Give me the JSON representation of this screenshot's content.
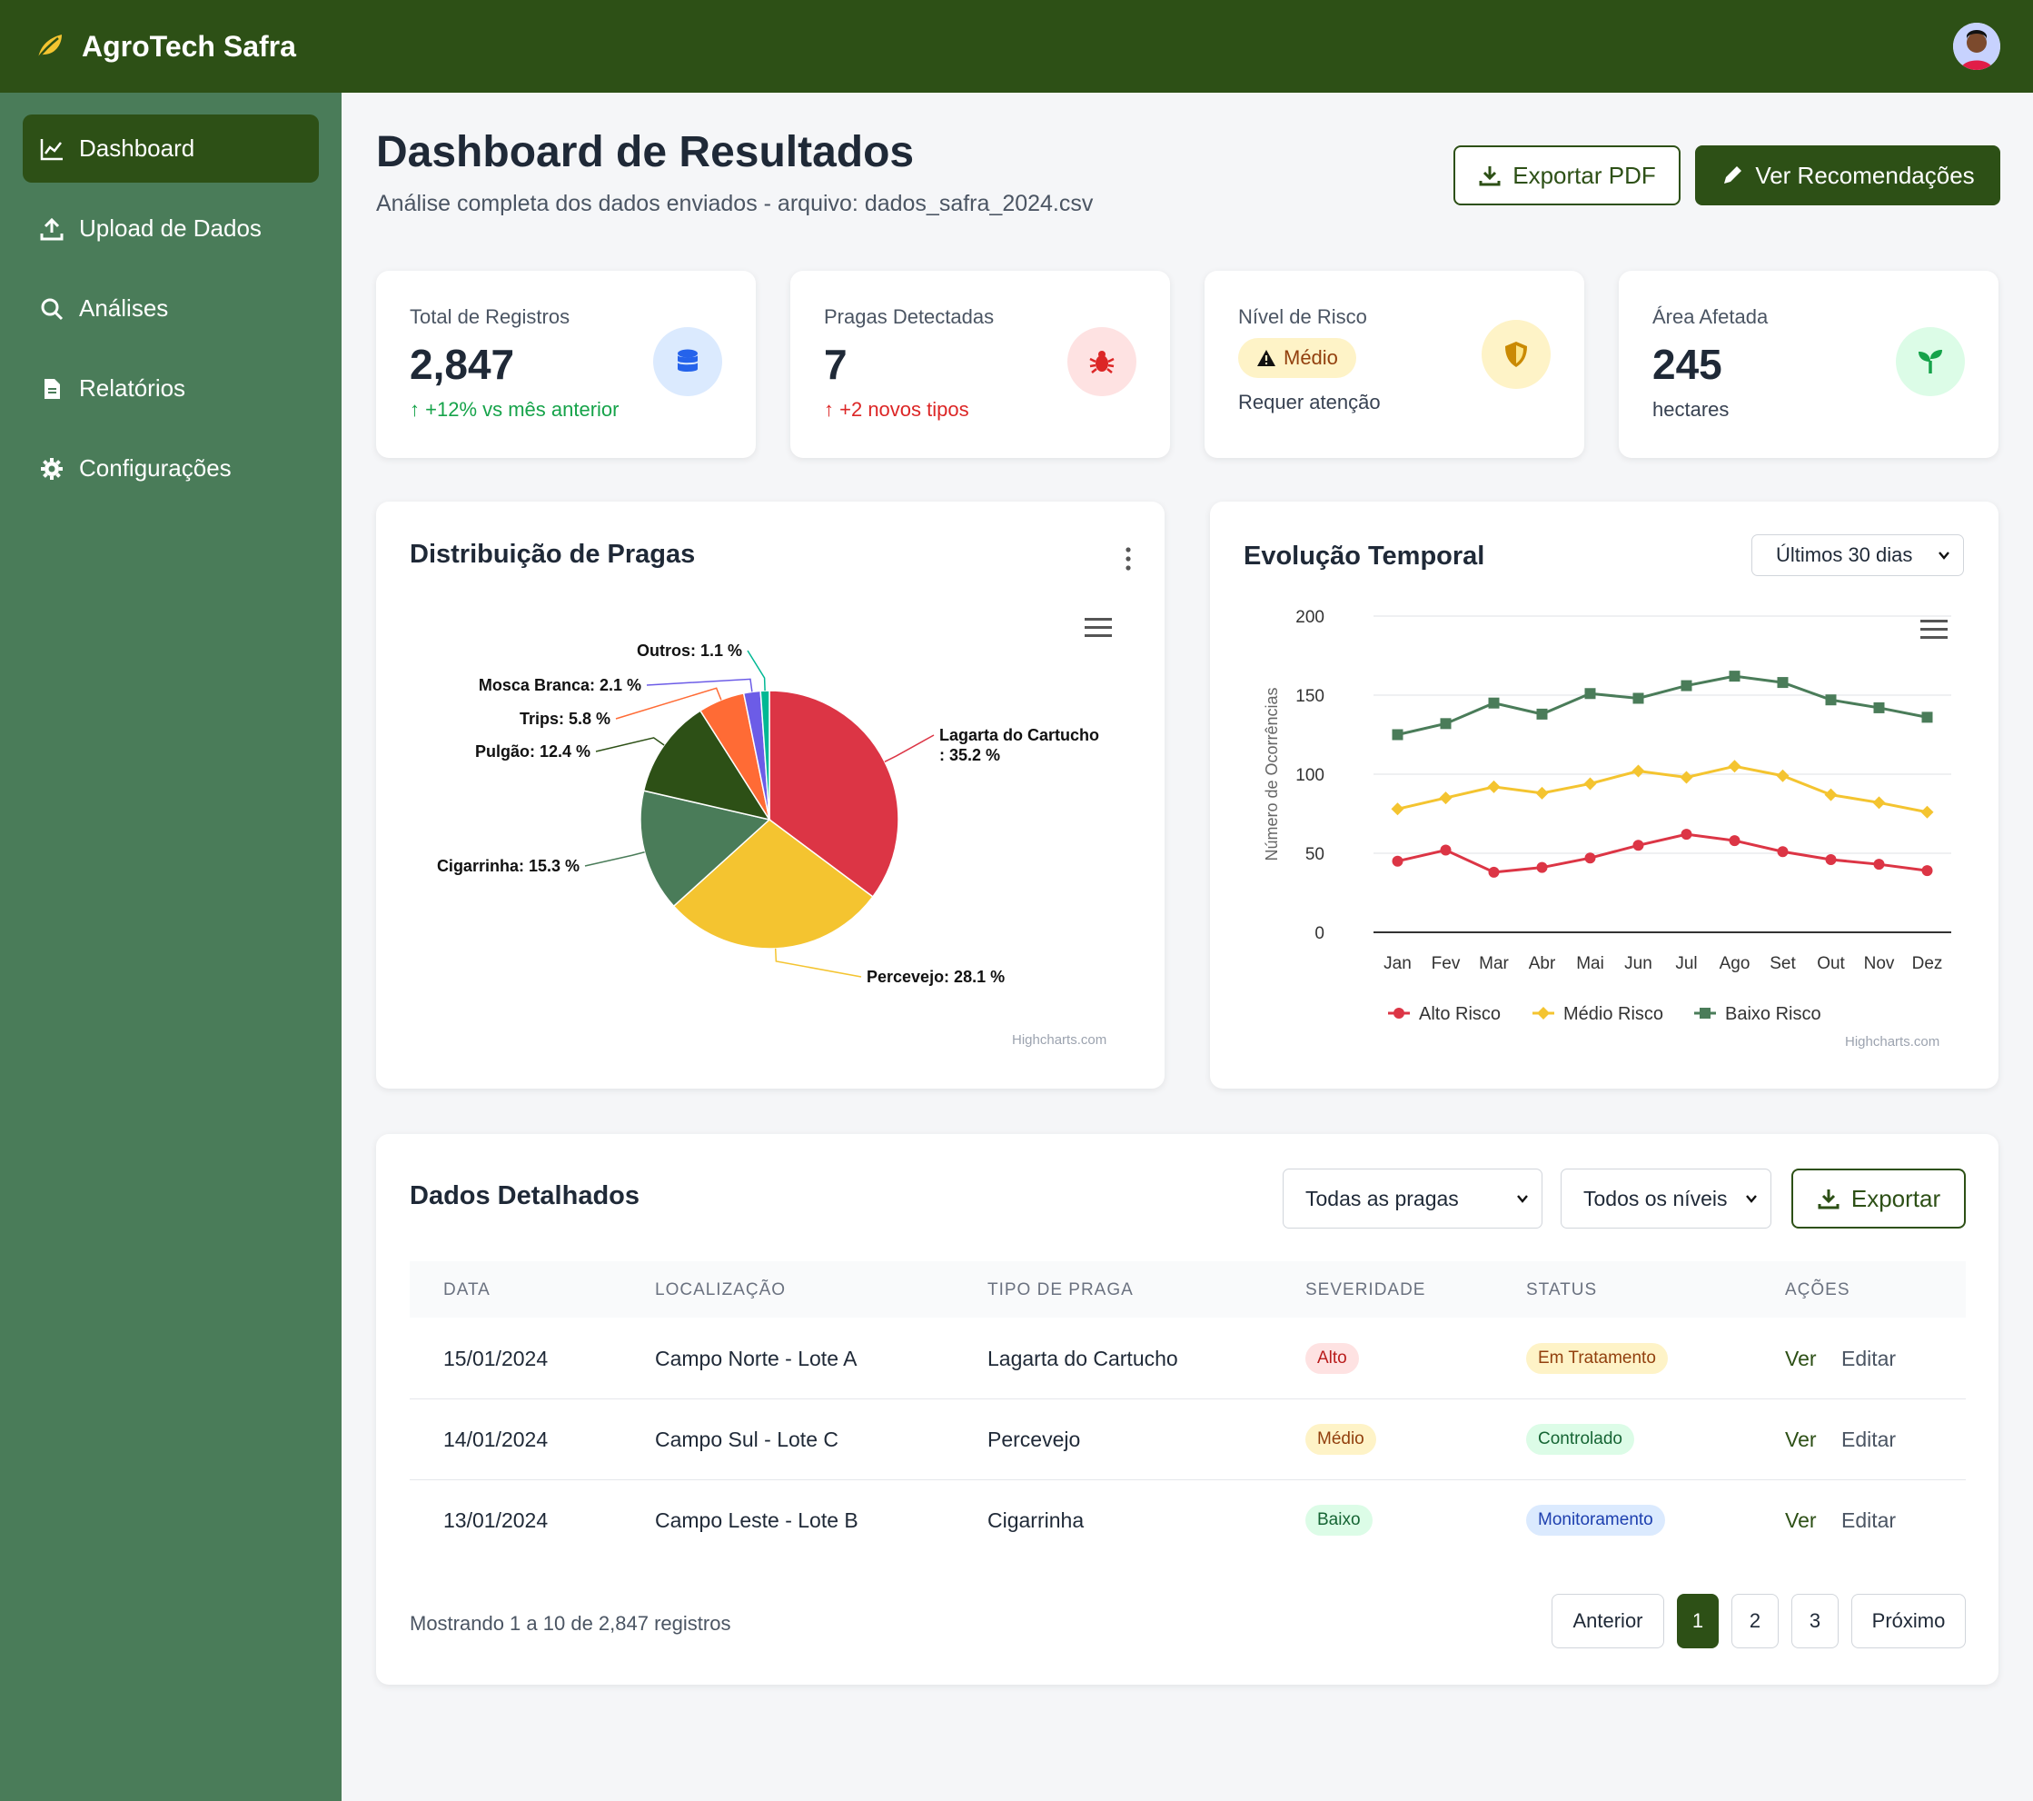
{
  "app": {
    "brand": "AgroTech Safra"
  },
  "sidebar": {
    "items": [
      {
        "label": "Dashboard",
        "icon": "chart-line-icon",
        "active": true
      },
      {
        "label": "Upload de Dados",
        "icon": "upload-icon"
      },
      {
        "label": "Análises",
        "icon": "search-icon"
      },
      {
        "label": "Relatórios",
        "icon": "file-icon"
      },
      {
        "label": "Configurações",
        "icon": "gear-icon"
      }
    ]
  },
  "header": {
    "title": "Dashboard de Resultados",
    "subtitle": "Análise completa dos dados enviados - arquivo: dados_safra_2024.csv",
    "export_pdf_label": "Exportar PDF",
    "recommendations_label": "Ver Recomendações"
  },
  "stats": {
    "records": {
      "label": "Total de Registros",
      "value": "2,847",
      "sub": "+12% vs mês anterior",
      "icon": "database-icon"
    },
    "pests": {
      "label": "Pragas Detectadas",
      "value": "7",
      "sub": "+2 novos tipos",
      "icon": "bug-icon"
    },
    "risk": {
      "label": "Nível de Risco",
      "pill": "Médio",
      "sub": "Requer atenção",
      "icon": "shield-icon"
    },
    "area": {
      "label": "Área Afetada",
      "value": "245",
      "sub": "hectares",
      "icon": "seedling-icon"
    }
  },
  "pie_panel": {
    "title": "Distribuição de Pragas",
    "credits": "Highcharts.com"
  },
  "line_panel": {
    "title": "Evolução Temporal",
    "range_select": "Últimos 30 dias",
    "credits": "Highcharts.com"
  },
  "chart_data": [
    {
      "type": "pie",
      "title": "",
      "slices": [
        {
          "name": "Lagarta do Cartucho",
          "value": 35.2,
          "color": "#dc3545"
        },
        {
          "name": "Percevejo",
          "value": 28.1,
          "color": "#f4c430"
        },
        {
          "name": "Cigarrinha",
          "value": 15.3,
          "color": "#4a7c59"
        },
        {
          "name": "Pulgão",
          "value": 12.4,
          "color": "#2d5016"
        },
        {
          "name": "Trips",
          "value": 5.8,
          "color": "#ff6b35"
        },
        {
          "name": "Mosca Branca",
          "value": 2.1,
          "color": "#6c5ce7"
        },
        {
          "name": "Outros",
          "value": 1.1,
          "color": "#00b894"
        }
      ],
      "value_suffix": " %"
    },
    {
      "type": "line",
      "title": "",
      "categories": [
        "Jan",
        "Fev",
        "Mar",
        "Abr",
        "Mai",
        "Jun",
        "Jul",
        "Ago",
        "Set",
        "Out",
        "Nov",
        "Dez"
      ],
      "ylabel": "Número de Ocorrências",
      "xlabel": "",
      "ylim": [
        0,
        200
      ],
      "yticks": [
        0,
        50,
        100,
        150,
        200
      ],
      "grid": true,
      "legend": "bottom",
      "series": [
        {
          "name": "Alto Risco",
          "color": "#dc3545",
          "marker": "circle",
          "values": [
            45,
            52,
            38,
            41,
            47,
            55,
            62,
            58,
            51,
            46,
            43,
            39
          ]
        },
        {
          "name": "Médio Risco",
          "color": "#f4c430",
          "marker": "diamond",
          "values": [
            78,
            85,
            92,
            88,
            94,
            102,
            98,
            105,
            99,
            87,
            82,
            76
          ]
        },
        {
          "name": "Baixo Risco",
          "color": "#4a7c59",
          "marker": "square",
          "values": [
            125,
            132,
            145,
            138,
            151,
            148,
            156,
            162,
            158,
            147,
            142,
            136
          ]
        }
      ]
    }
  ],
  "table": {
    "title": "Dados Detalhados",
    "filter_pests": "Todas as pragas",
    "filter_levels": "Todos os níveis",
    "export_label": "Exportar",
    "columns": [
      "DATA",
      "LOCALIZAÇÃO",
      "TIPO DE PRAGA",
      "SEVERIDADE",
      "STATUS",
      "AÇÕES"
    ],
    "rows": [
      {
        "date": "15/01/2024",
        "location": "Campo Norte - Lote A",
        "pest": "Lagarta do Cartucho",
        "severity": "Alto",
        "status": "Em Tratamento",
        "view": "Ver",
        "edit": "Editar"
      },
      {
        "date": "14/01/2024",
        "location": "Campo Sul - Lote C",
        "pest": "Percevejo",
        "severity": "Médio",
        "status": "Controlado",
        "view": "Ver",
        "edit": "Editar"
      },
      {
        "date": "13/01/2024",
        "location": "Campo Leste - Lote B",
        "pest": "Cigarrinha",
        "severity": "Baixo",
        "status": "Monitoramento",
        "view": "Ver",
        "edit": "Editar"
      }
    ],
    "summary": "Mostrando 1 a 10 de 2,847 registros",
    "pagination": {
      "prev": "Anterior",
      "pages": [
        "1",
        "2",
        "3"
      ],
      "next": "Próximo",
      "current": "1"
    }
  }
}
